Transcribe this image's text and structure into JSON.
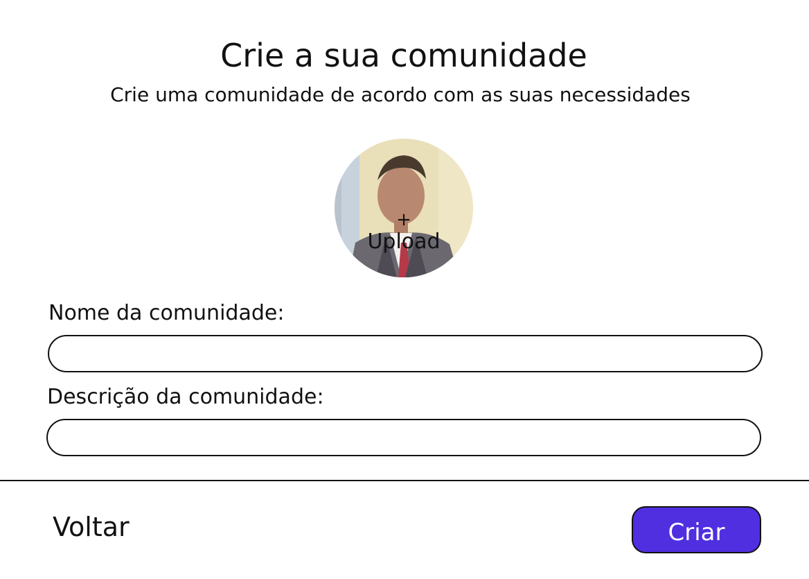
{
  "header": {
    "title": "Crie a sua comunidade",
    "subtitle": "Crie uma comunidade de acordo com as suas necessidades"
  },
  "upload": {
    "plus": "+",
    "label": "Upload",
    "icon": "profile-photo"
  },
  "form": {
    "name_label": "Nome da comunidade:",
    "name_value": "",
    "name_placeholder": "",
    "description_label": "Descrição da comunidade:",
    "description_value": "",
    "description_placeholder": ""
  },
  "footer": {
    "back_label": "Voltar",
    "create_label": "Criar"
  },
  "colors": {
    "accent": "#4f2fe0",
    "border": "#111111",
    "background": "#ffffff"
  }
}
